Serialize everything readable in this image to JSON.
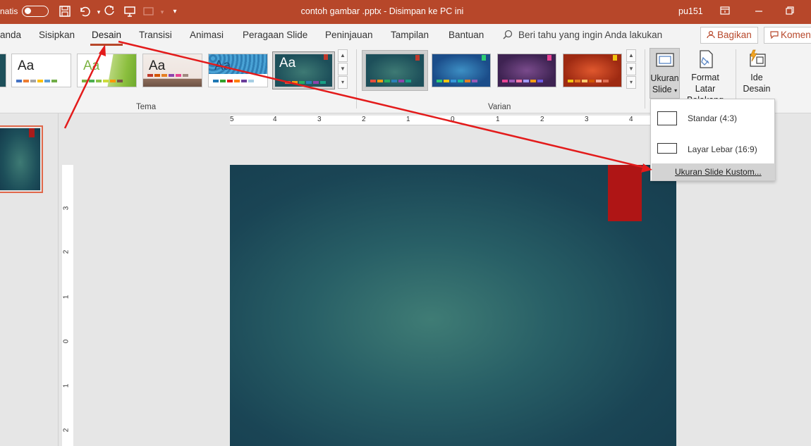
{
  "titlebar": {
    "autosave_label": "natis",
    "doc_title": "contoh gambar .pptx  -  Disimpan ke PC ini",
    "user": "pu151"
  },
  "tabs": [
    "anda",
    "Sisipkan",
    "Desain",
    "Transisi",
    "Animasi",
    "Peragaan Slide",
    "Peninjauan",
    "Tampilan",
    "Bantuan"
  ],
  "active_tab": "Desain",
  "tell_me": "Beri tahu yang ingin Anda lakukan",
  "share_label": "Bagikan",
  "comment_label": "Komen",
  "themes": {
    "group_label": "Tema",
    "sample_text": "Aa"
  },
  "variants": {
    "group_label": "Varian"
  },
  "buttons": {
    "slide_size_line1": "Ukuran",
    "slide_size_line2": "Slide",
    "format_bg_line1": "Format Latar",
    "format_bg_line2": "Belakang",
    "design_ideas_line1": "Ide",
    "design_ideas_line2": "Desain"
  },
  "dropdown": {
    "standard": "Standar (4:3)",
    "widescreen": "Layar Lebar (16:9)",
    "custom": "Ukuran Slide Kustom..."
  },
  "ruler": {
    "horizontal": [
      "5",
      "4",
      "3",
      "2",
      "1",
      "0",
      "1",
      "2",
      "3",
      "4"
    ],
    "vertical": [
      "3",
      "2",
      "1",
      "0",
      "1",
      "2"
    ]
  },
  "colors": {
    "accent": "#b7472a",
    "annotation": "#e31b1b",
    "slide_tag": "#af1515"
  }
}
